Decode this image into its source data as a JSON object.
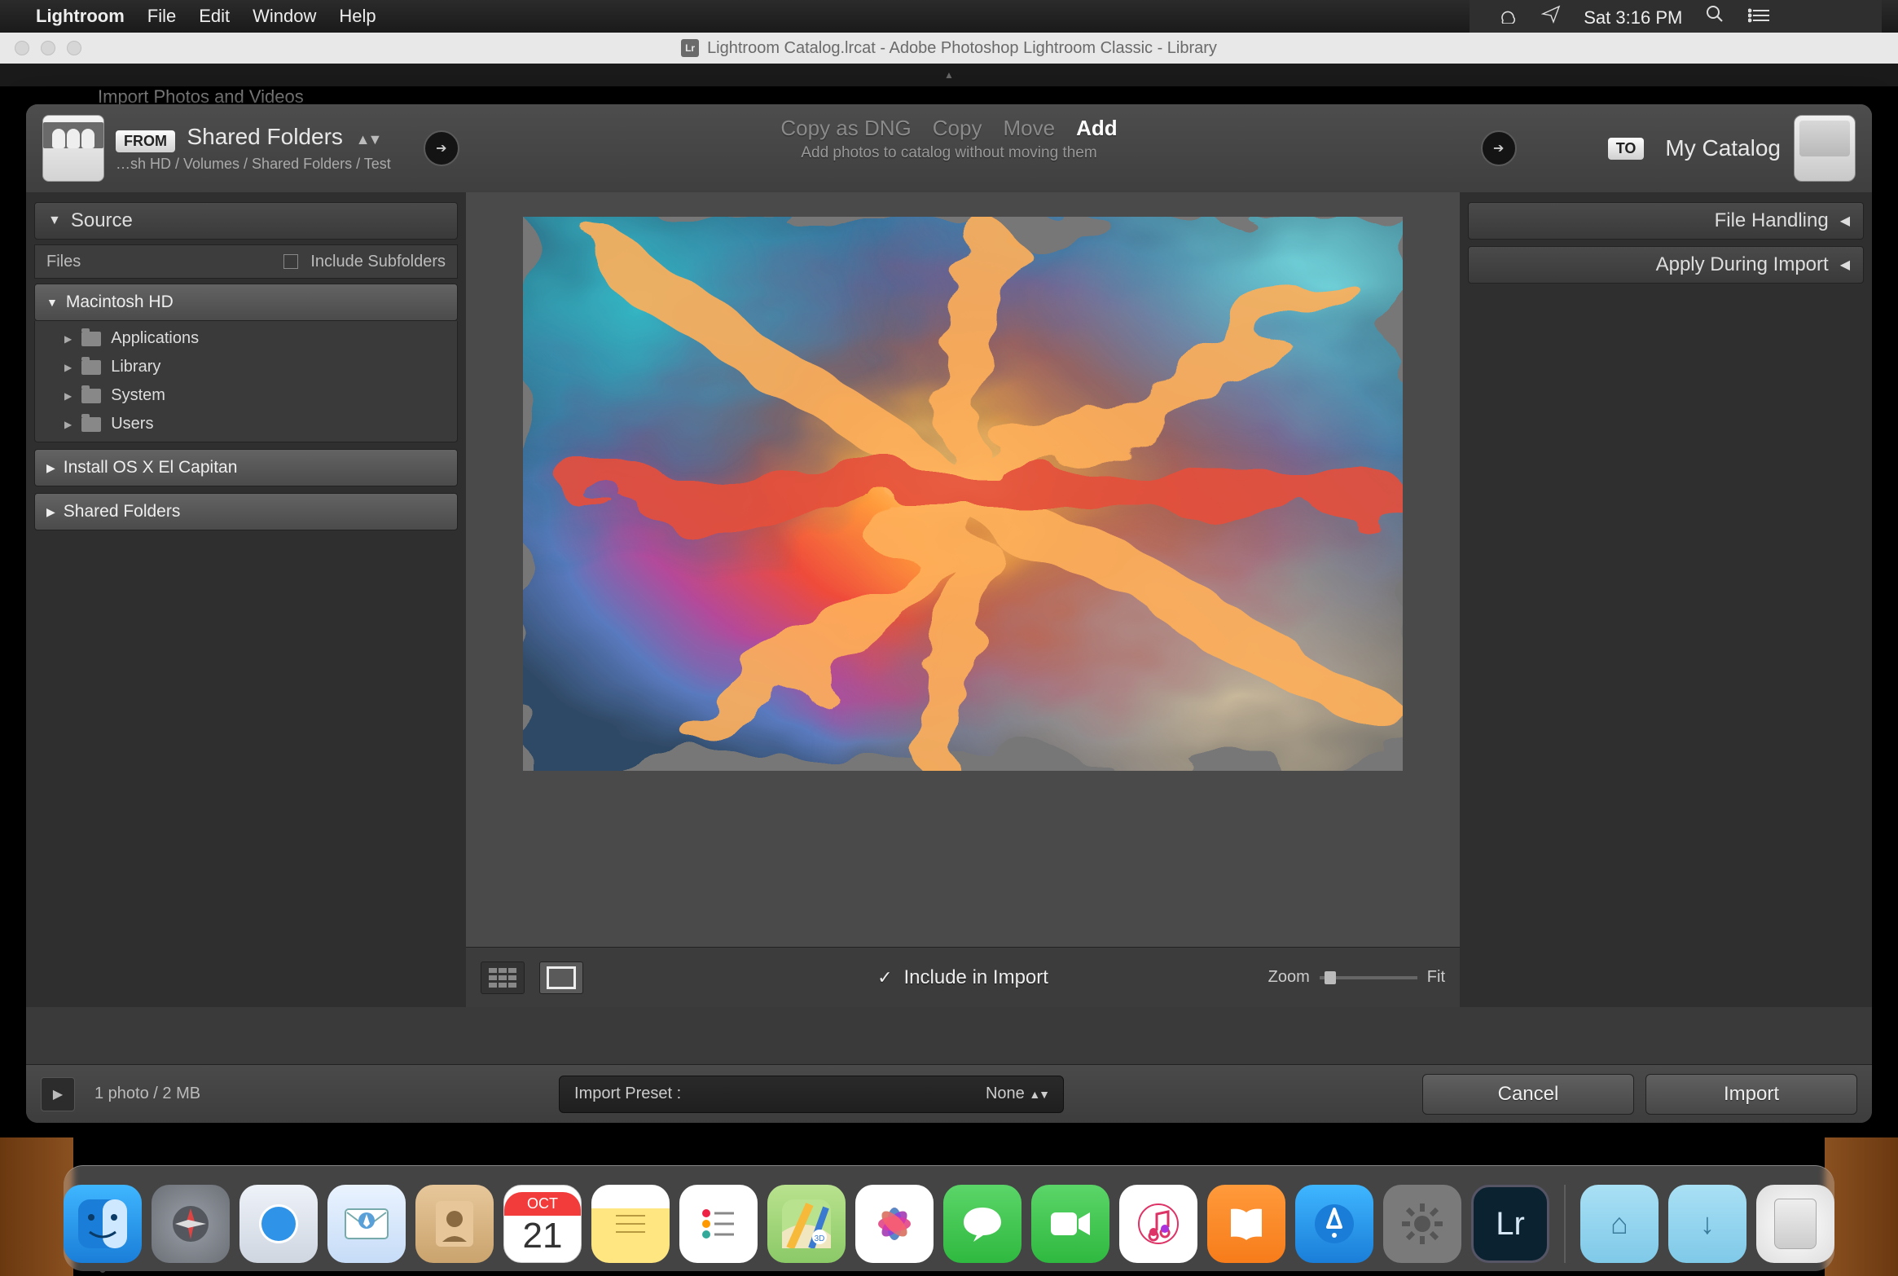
{
  "menubar": {
    "app": "Lightroom",
    "items": [
      "File",
      "Edit",
      "Window",
      "Help"
    ],
    "time": "Sat 3:16 PM"
  },
  "window_title": "Lightroom Catalog.lrcat - Adobe Photoshop Lightroom Classic - Library",
  "hidden_header": "Import Photos and Videos",
  "from": {
    "badge": "FROM",
    "title": "Shared Folders",
    "path": "…sh HD / Volumes / Shared Folders / Test"
  },
  "to": {
    "badge": "TO",
    "title": "My Catalog"
  },
  "modes": {
    "items": [
      "Copy as DNG",
      "Copy",
      "Move",
      "Add"
    ],
    "active": "Add",
    "subtitle": "Add photos to catalog without moving them"
  },
  "left": {
    "header": "Source",
    "files_label": "Files",
    "include_subfolders": "Include Subfolders",
    "drives": [
      {
        "name": "Macintosh HD",
        "expanded": true,
        "children": [
          "Applications",
          "Library",
          "System",
          "Users"
        ]
      },
      {
        "name": "Install OS X El Capitan",
        "expanded": false
      },
      {
        "name": "Shared Folders",
        "expanded": false
      }
    ]
  },
  "right": {
    "panels": [
      "File Handling",
      "Apply During Import"
    ]
  },
  "center_bar": {
    "include_label": "Include in Import",
    "zoom_label": "Zoom",
    "fit_label": "Fit"
  },
  "footer": {
    "count": "1 photo / 2 MB",
    "preset_label": "Import Preset :",
    "preset_value": "None",
    "cancel": "Cancel",
    "import": "Import"
  },
  "dock": {
    "calendar_month": "OCT",
    "calendar_day": "21",
    "lr_label": "Lr"
  }
}
